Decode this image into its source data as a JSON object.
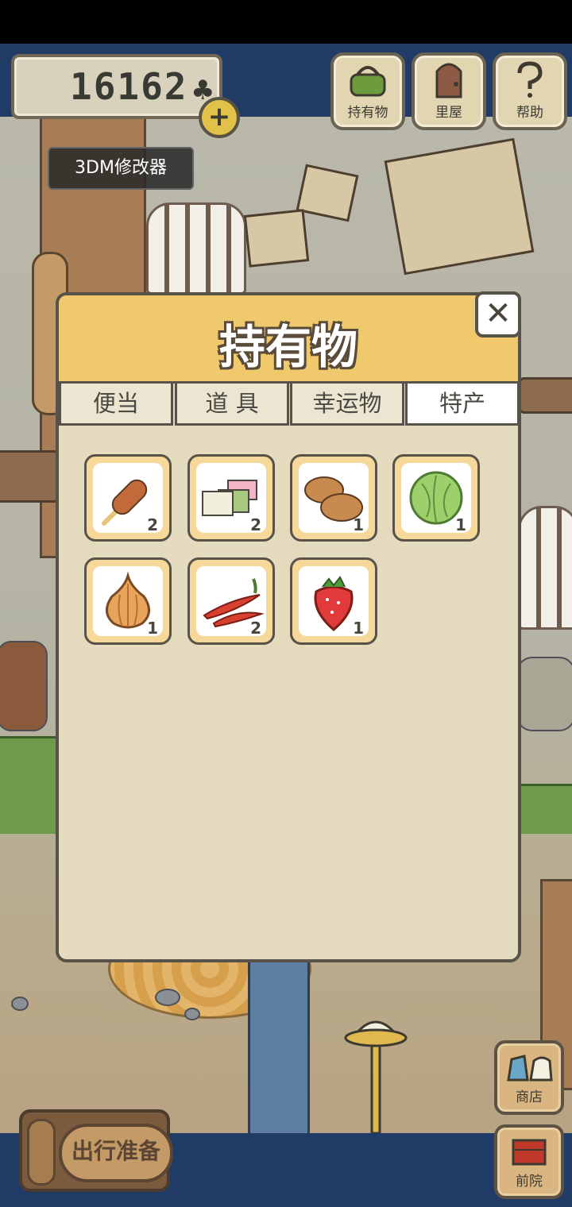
{
  "hud": {
    "clover_count": "16162",
    "clover_icon": "♣",
    "plus_icon": "+",
    "overlay_label": "3DM修改器",
    "buttons": [
      {
        "name": "inventory",
        "label": "持有物",
        "icon": "bag-icon"
      },
      {
        "name": "back-room",
        "label": "里屋",
        "icon": "door-icon"
      },
      {
        "name": "help",
        "label": "帮助",
        "icon": "question-icon"
      }
    ]
  },
  "dialog": {
    "title": "持有物",
    "close_icon": "✕",
    "tabs": [
      {
        "label": "便当",
        "active": false
      },
      {
        "label": "道 具",
        "active": false
      },
      {
        "label": "幸运物",
        "active": false
      },
      {
        "label": "特产",
        "active": true
      }
    ],
    "items": [
      {
        "name": "grilled-skewer",
        "count": "2"
      },
      {
        "name": "tricolor-mochi",
        "count": "2"
      },
      {
        "name": "steamed-buns",
        "count": "1"
      },
      {
        "name": "cabbage",
        "count": "1"
      },
      {
        "name": "onion",
        "count": "1"
      },
      {
        "name": "red-peppers",
        "count": "2"
      },
      {
        "name": "strawberry",
        "count": "1"
      }
    ]
  },
  "side_buttons": {
    "shop": {
      "label": "商店",
      "icon": "shop-icon"
    },
    "yard": {
      "label": "前院",
      "icon": "yard-icon"
    }
  },
  "depart": {
    "label": "出行准备"
  }
}
